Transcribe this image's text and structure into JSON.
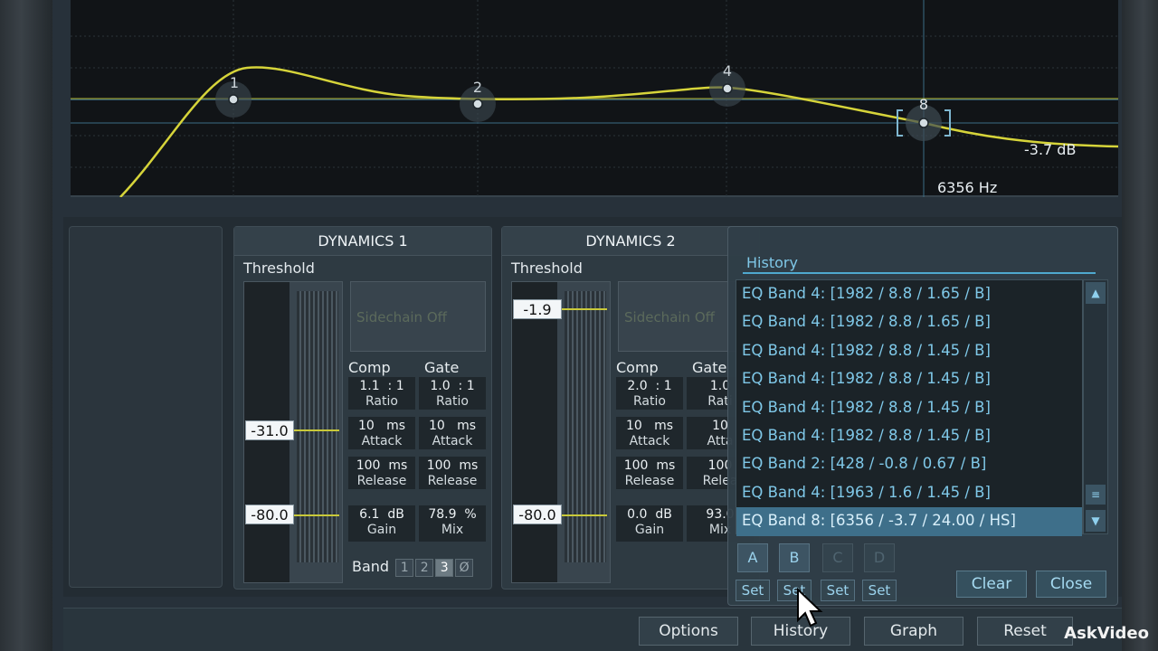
{
  "graph": {
    "freq_readout": "6356 Hz",
    "gain_readout": "-3.7 dB",
    "nodes": [
      "1",
      "2",
      "4",
      "8"
    ]
  },
  "dynamics1": {
    "title": "DYNAMICS 1",
    "threshold_label": "Threshold",
    "threshold_value": "-31.0",
    "floor_value": "-80.0",
    "sidechain": "Sidechain Off",
    "comp_label": "Comp",
    "gate_label": "Gate",
    "comp_ratio": "1.1  : 1",
    "gate_ratio": "1.0  : 1",
    "ratio_label": "Ratio",
    "comp_attack": "10   ms",
    "gate_attack": "10   ms",
    "attack_label": "Attack",
    "comp_release": "100  ms",
    "gate_release": "100  ms",
    "release_label": "Release",
    "gain": "6.1  dB",
    "gain_label": "Gain",
    "mix": "78.9  %",
    "mix_label": "Mix",
    "band_label": "Band",
    "bands": [
      "1",
      "2",
      "3",
      "Ø"
    ]
  },
  "dynamics2": {
    "title": "DYNAMICS 2",
    "threshold_label": "Threshold",
    "threshold_value": "-1.9",
    "floor_value": "-80.0",
    "sidechain": "Sidechain Off",
    "comp_label": "Comp",
    "gate_label": "Gate",
    "comp_ratio": "2.0  : 1",
    "gate_ratio": "1.0",
    "ratio_label": "Ratio",
    "gate_ratio_label": "Rati",
    "comp_attack": "10   ms",
    "gate_attack": "10",
    "attack_label": "Attack",
    "gate_attack_label": "Atta",
    "comp_release": "100  ms",
    "gate_release": "100",
    "release_label": "Release",
    "gate_release_label": "Relea",
    "gain": "0.0  dB",
    "gain_label": "Gain",
    "mix": "93.0",
    "mix_label": "Mix"
  },
  "history": {
    "title": "History",
    "items": [
      "EQ Band 4: [1982 / 8.8 / 1.65 / B]",
      "EQ Band 4: [1982 / 8.8 / 1.65 / B]",
      "EQ Band 4: [1982 / 8.8 / 1.45 / B]",
      "EQ Band 4: [1982 / 8.8 / 1.45 / B]",
      "EQ Band 4: [1982 / 8.8 / 1.45 / B]",
      "EQ Band 4: [1982 / 8.8 / 1.45 / B]",
      "EQ Band 2: [428 / -0.8 / 0.67 / B]",
      "EQ Band 4: [1963 / 1.6 / 1.45 / B]",
      "EQ Band 8: [6356 / -3.7 / 24.00 / HS]"
    ],
    "slots": [
      "A",
      "B",
      "C",
      "D"
    ],
    "set_label": "Set",
    "clear_label": "Clear",
    "close_label": "Close"
  },
  "toolbar": {
    "options": "Options",
    "history": "History",
    "graph": "Graph",
    "reset": "Reset"
  },
  "watermark": "AskVideo",
  "colors": {
    "curve": "#d6d43a",
    "accent": "#7fc8e8",
    "selected": "#3e6f8a"
  }
}
